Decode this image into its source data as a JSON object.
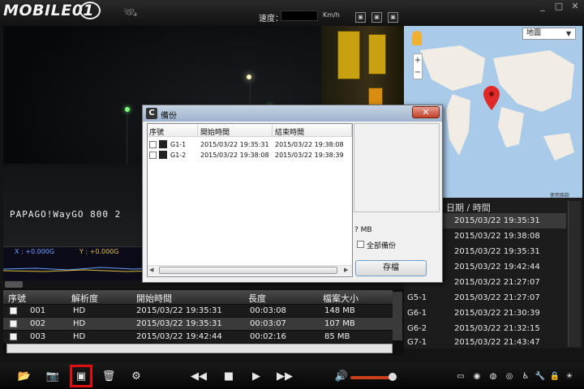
{
  "app": {
    "logo_text": "MOBILE01",
    "watermark_text": "PAPAGO!"
  },
  "header": {
    "speed_label": "速度：",
    "speed_unit": "Km/h",
    "window_buttons": [
      "_",
      "□",
      "✕"
    ]
  },
  "video": {
    "overlay": "PAPAGO!WayGO 800 2"
  },
  "gsensor": {
    "x_label": "X : +0.000G",
    "y_label": "Y : +0.000G"
  },
  "map": {
    "select_value": "地圖",
    "attribution": "使用條款"
  },
  "right_list": {
    "header": "日期 / 時間",
    "rows": [
      {
        "id": "",
        "datetime": "2015/03/22  19:35:31"
      },
      {
        "id": "",
        "datetime": "2015/03/22  19:38:08"
      },
      {
        "id": "",
        "datetime": "2015/03/22  19:35:31"
      },
      {
        "id": "",
        "datetime": "2015/03/22  19:42:44"
      },
      {
        "id": "",
        "datetime": "2015/03/22  21:27:07"
      },
      {
        "id": "G5-1",
        "datetime": "2015/03/22  21:27:07"
      },
      {
        "id": "G6-1",
        "datetime": "2015/03/22  21:30:39"
      },
      {
        "id": "G6-2",
        "datetime": "2015/03/22  21:32:15"
      },
      {
        "id": "G7-1",
        "datetime": "2015/03/22  21:43:47"
      }
    ]
  },
  "table": {
    "headers": [
      "序號",
      "解析度",
      "開始時間",
      "長度",
      "檔案大小"
    ],
    "rows": [
      {
        "id": "001",
        "res": "HD",
        "start": "2015/03/22 19:35:31",
        "length": "00:03:08",
        "size": "148 MB"
      },
      {
        "id": "002",
        "res": "HD",
        "start": "2015/03/22 19:35:31",
        "length": "00:03:07",
        "size": "107 MB"
      },
      {
        "id": "003",
        "res": "HD",
        "start": "2015/03/22 19:42:44",
        "length": "00:02:16",
        "size": "85 MB"
      }
    ]
  },
  "dialog": {
    "title": "備份",
    "close_label": "✕",
    "headers": [
      "序號",
      "開始時間",
      "結束時間"
    ],
    "rows": [
      {
        "id": "G1-1",
        "start": "2015/03/22 19:35:31",
        "end": "2015/03/22 19:38:08"
      },
      {
        "id": "G1-2",
        "start": "2015/03/22 19:38:08",
        "end": "2015/03/22 19:38:39"
      }
    ],
    "size_text": "?  MB",
    "all_backup_label": "全部備份",
    "save_label": "存檔"
  },
  "toolbar": {
    "icons": [
      "folder-icon",
      "camera-icon",
      "backup-icon",
      "trash-icon",
      "gear-icon",
      "rewind-icon",
      "stop-icon",
      "play-icon",
      "fast-forward-icon",
      "volume-icon"
    ],
    "volume_level": 0.9
  },
  "colors": {
    "highlight": "#e01010",
    "volume": "#c8401a",
    "map_water": "#a9cbe9"
  }
}
